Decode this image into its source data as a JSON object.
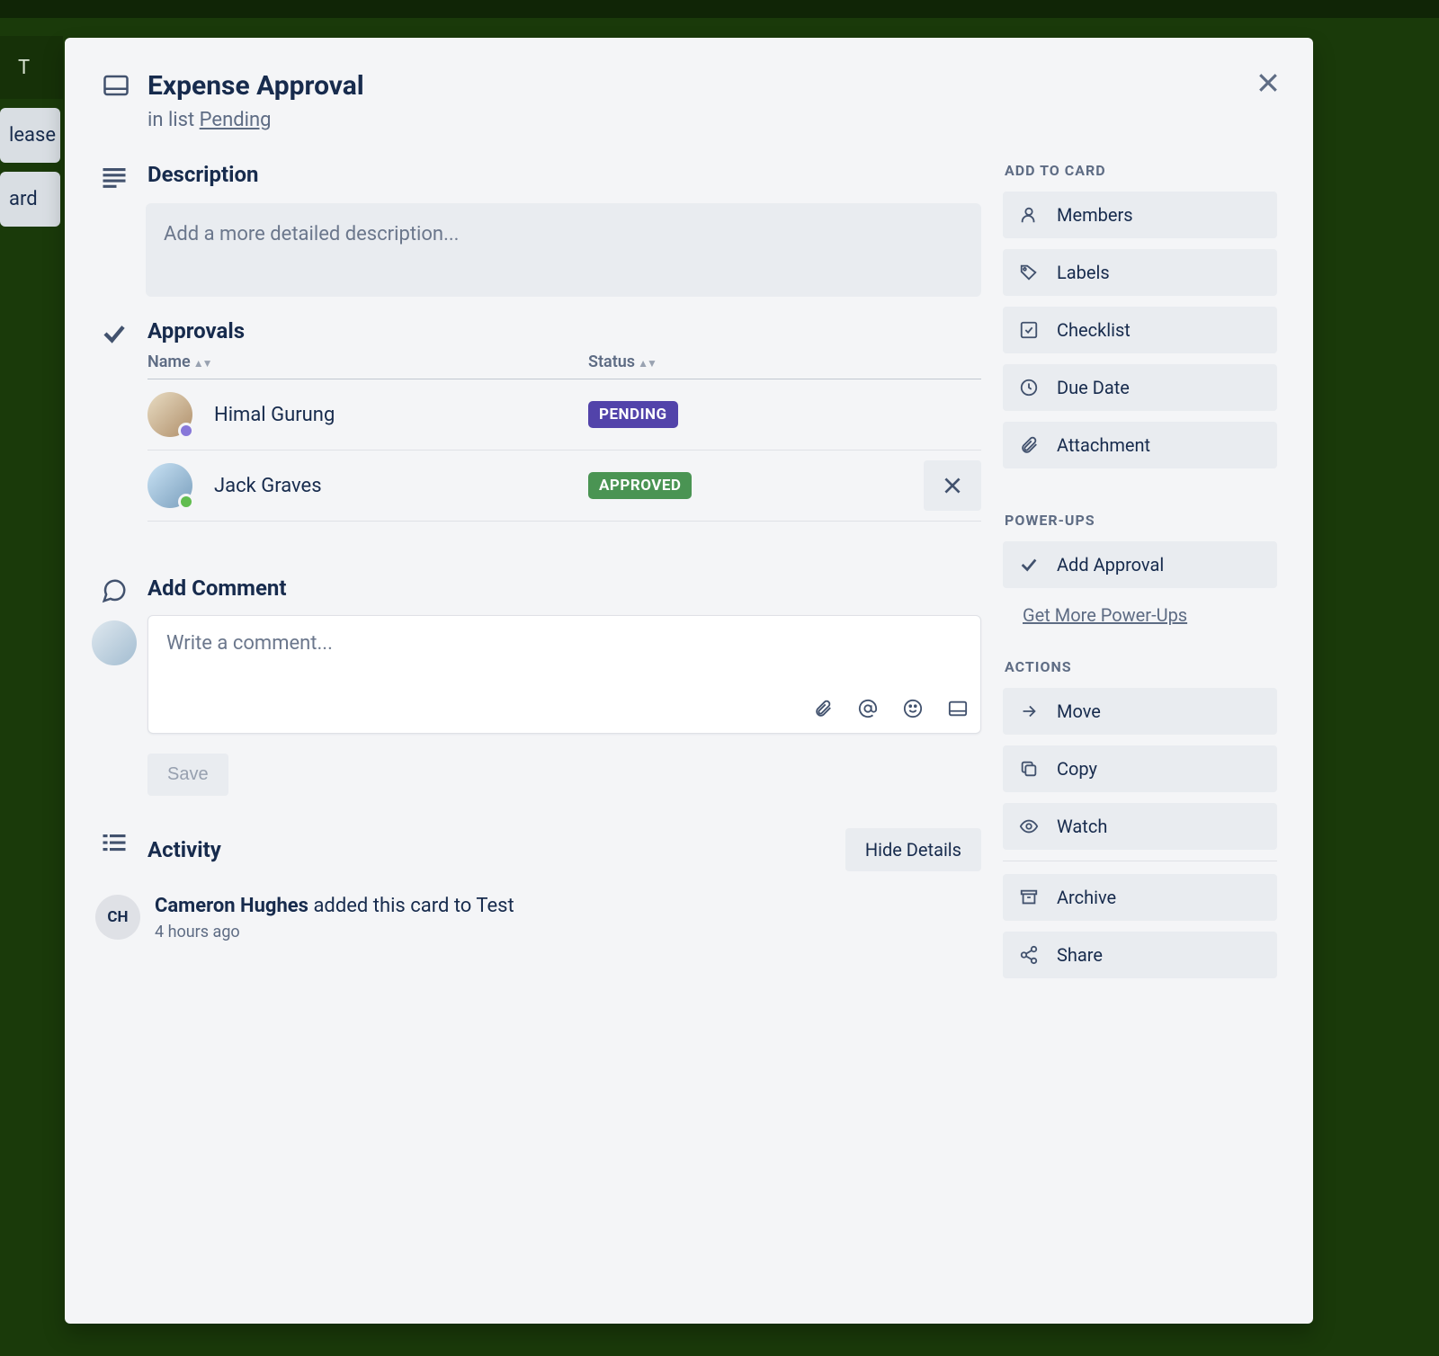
{
  "background": {
    "lists": [
      "lease .",
      "ard"
    ]
  },
  "card": {
    "title": "Expense Approval",
    "in_list_prefix": "in list ",
    "list_name": "Pending"
  },
  "description": {
    "title": "Description",
    "placeholder": "Add a more detailed description..."
  },
  "approvals": {
    "title": "Approvals",
    "columns": {
      "name": "Name",
      "status": "Status"
    },
    "rows": [
      {
        "name": "Himal Gurung",
        "status_label": "PENDING",
        "status": "pending",
        "dot": "purple",
        "show_x": false
      },
      {
        "name": "Jack Graves",
        "status_label": "APPROVED",
        "status": "approved",
        "dot": "green",
        "show_x": true
      }
    ]
  },
  "comment": {
    "title": "Add Comment",
    "placeholder": "Write a comment...",
    "save": "Save"
  },
  "activity": {
    "title": "Activity",
    "hide": "Hide Details",
    "items": [
      {
        "initials": "CH",
        "actor": "Cameron Hughes",
        "action": " added this card to Test",
        "time": "4 hours ago"
      }
    ]
  },
  "sidebar": {
    "add_to_card": "ADD TO CARD",
    "members": "Members",
    "labels": "Labels",
    "checklist": "Checklist",
    "due_date": "Due Date",
    "attachment": "Attachment",
    "power_ups": "POWER-UPS",
    "add_approval": "Add Approval",
    "more_powerups": "Get More Power-Ups",
    "actions": "ACTIONS",
    "move": "Move",
    "copy": "Copy",
    "watch": "Watch",
    "archive": "Archive",
    "share": "Share"
  }
}
